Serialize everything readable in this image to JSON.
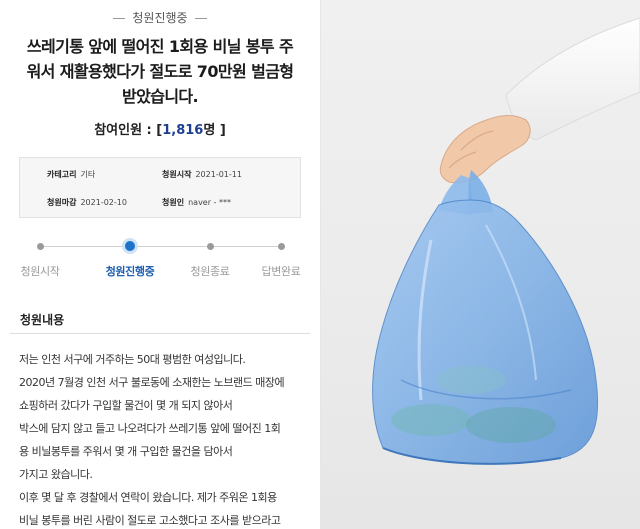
{
  "petition": {
    "status_top": "청원진행중",
    "title": "쓰레기통 앞에 떨어진 1회용 비닐 봉투 주워서 재활용했다가 절도로 70만원 벌금형 받았습니다.",
    "participants_label": "참여인원 : [",
    "participants_count": "1,816",
    "participants_unit": "명 ]"
  },
  "info": {
    "category_label": "카테고리",
    "category_value": "기타",
    "start_label": "청원시작",
    "start_value": "2021-01-11",
    "end_label": "청원마감",
    "end_value": "2021-02-10",
    "author_label": "청원인",
    "author_value": "naver - ***"
  },
  "steps": [
    {
      "label": "청원시작",
      "active": false
    },
    {
      "label": "청원진행중",
      "active": true
    },
    {
      "label": "청원종료",
      "active": false
    },
    {
      "label": "답변완료",
      "active": false
    }
  ],
  "content": {
    "section_title": "청원내용",
    "lines": [
      "저는 인천 서구에 거주하는 50대 평범한 여성입니다.",
      "2020년 7월경 인천 서구 불로동에 소재한는 노브랜드 매장에",
      "쇼핑하러 갔다가 구입할 물건이 몇 개 되지 않아서",
      "박스에 담지 않고 들고 나오려다가 쓰레기통 앞에 떨어진 1회",
      "용 비닐봉투를 주워서 몇 개 구입한 물건을 담아서",
      "가지고 왔습니다.",
      "이후 몇 달 후 경찰에서 연락이 왔습니다. 제가 주워온 1회용",
      "비닐 봉투를 버린 사람이 절도로 고소했다고 조사를 받으라고"
    ]
  },
  "colors": {
    "accent": "#1e73c9",
    "count": "#1c3f8f",
    "bag": "#7fb0e6"
  },
  "photo": {
    "subject": "hand-holding-plastic-bag"
  }
}
